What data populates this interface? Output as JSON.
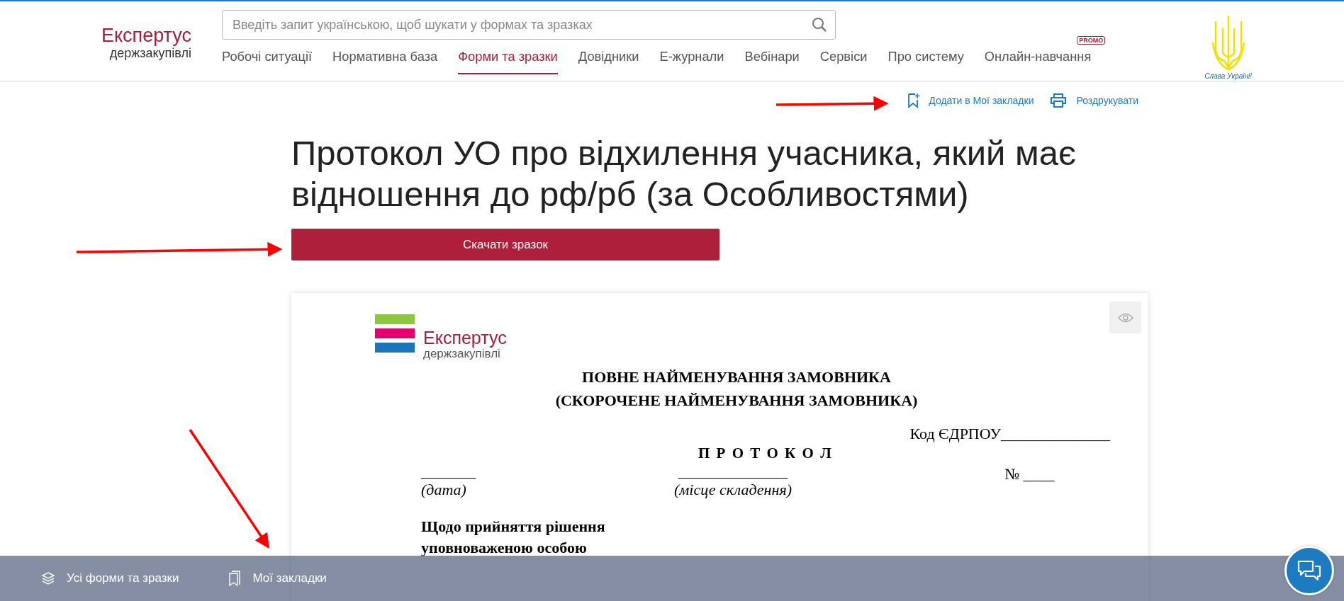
{
  "header": {
    "logo": {
      "name": "Експертус",
      "sub": "держзакупівлі"
    },
    "search": {
      "placeholder": "Введіть запит українською, щоб шукати у формах та зразках"
    },
    "nav": [
      {
        "label": "Робочі ситуації",
        "selected": false
      },
      {
        "label": "Нормативна база",
        "selected": false
      },
      {
        "label": "Форми та зразки",
        "selected": true
      },
      {
        "label": "Довідники",
        "selected": false
      },
      {
        "label": "Е-журнали",
        "selected": false
      },
      {
        "label": "Вебінари",
        "selected": false
      },
      {
        "label": "Сервіси",
        "selected": false
      },
      {
        "label": "Про систему",
        "selected": false
      },
      {
        "label": "Онлайн-навчання",
        "selected": false,
        "badge": "PROMO"
      }
    ],
    "emblem_caption": "Слава Україні!"
  },
  "actions": [
    {
      "kind": "bookmark",
      "label": "Додати в Мої закладки"
    },
    {
      "kind": "print",
      "label": "Роздрукувати"
    }
  ],
  "title": "Протокол УО про відхилення учасника, який має відношення до рф/рб (за Особливостями)",
  "download_button": "Скачати зразок",
  "document": {
    "logo": {
      "name": "Експертус",
      "sub": "держзакупівлі"
    },
    "heading": [
      "ПОВНЕ НАЙМЕНУВАННЯ ЗАМОВНИКА",
      "(СКОРОЧЕНЕ НАЙМЕНУВАННЯ ЗАМОВНИКА)"
    ],
    "code": "Код ЄДРПОУ______________",
    "protocol": "П Р О Т О К О Л",
    "date_line": "_______",
    "date_caption": "(дата)",
    "place_line": "______________",
    "place_caption": "(місце складення)",
    "number": "№ ____",
    "subject": [
      "Щодо прийняття рішення",
      "уповноваженою особою"
    ]
  },
  "bottom_bar": [
    {
      "kind": "layers",
      "label": "Усі форми та зразки"
    },
    {
      "kind": "bookmark",
      "label": "Мої закладки"
    }
  ]
}
